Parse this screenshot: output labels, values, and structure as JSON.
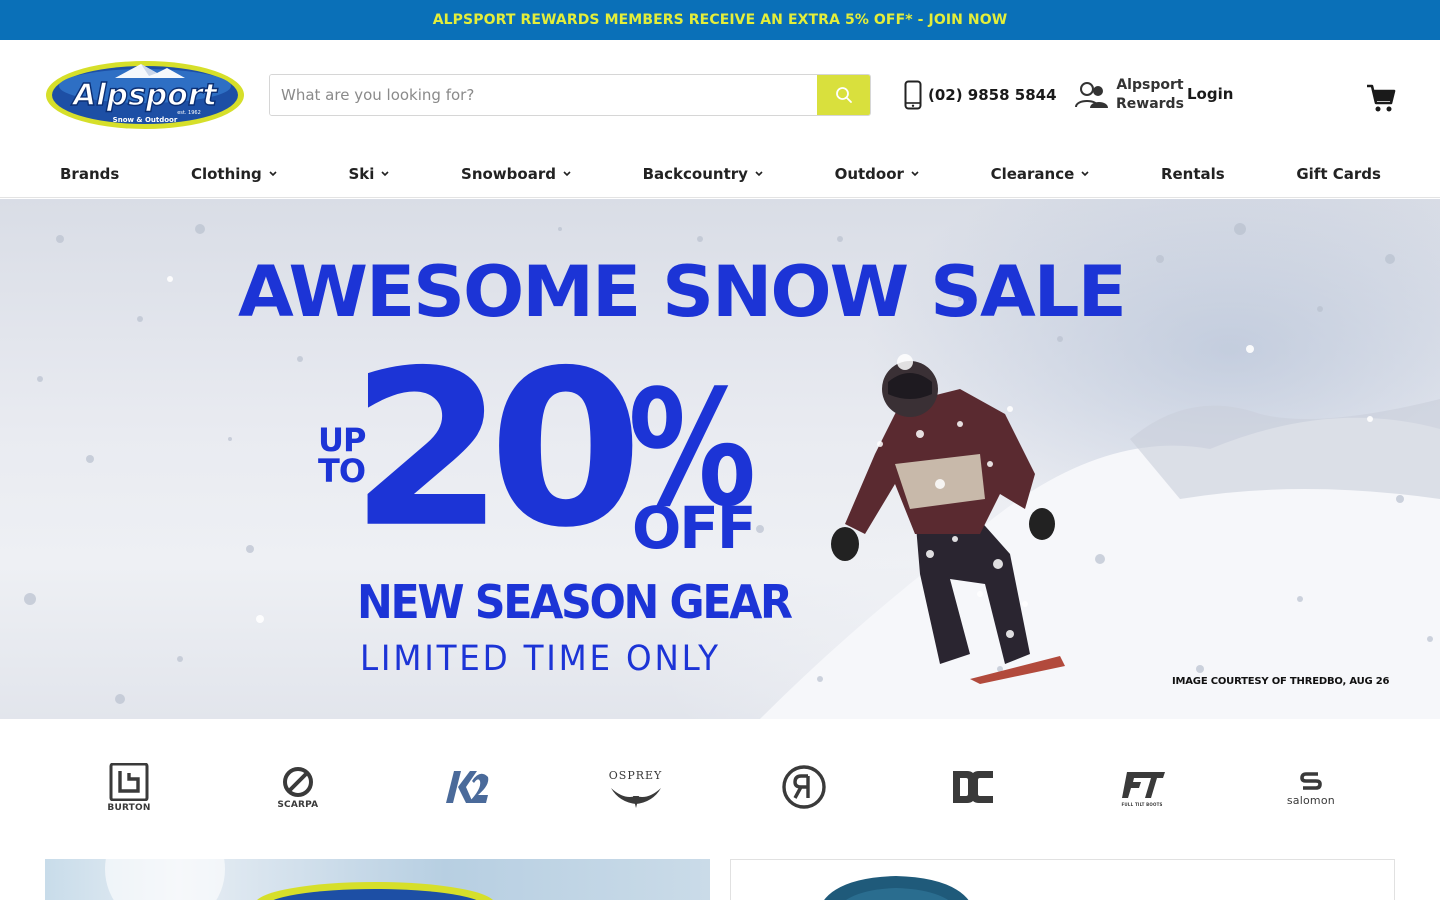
{
  "announcement": {
    "text": "ALPSPORT REWARDS MEMBERS RECEIVE AN EXTRA 5% OFF* - JOIN NOW",
    "text_color": "#e4ee3a",
    "background": "#0a70b8"
  },
  "header": {
    "logo": {
      "name": "Alpsport",
      "est": "est. 1962",
      "tagline": "Snow & Outdoor"
    },
    "search": {
      "placeholder": "What are you looking for?",
      "button_color": "#d9e03d"
    },
    "phone": "(02) 9858 5844",
    "rewards": {
      "line1": "Alpsport",
      "line2": "Rewards"
    },
    "login": "Login"
  },
  "nav": {
    "items": [
      {
        "label": "Brands",
        "dropdown": false
      },
      {
        "label": "Clothing",
        "dropdown": true
      },
      {
        "label": "Ski",
        "dropdown": true
      },
      {
        "label": "Snowboard",
        "dropdown": true
      },
      {
        "label": "Backcountry",
        "dropdown": true
      },
      {
        "label": "Outdoor",
        "dropdown": true
      },
      {
        "label": "Clearance",
        "dropdown": true
      },
      {
        "label": "Rentals",
        "dropdown": false
      },
      {
        "label": "Gift Cards",
        "dropdown": false
      }
    ]
  },
  "hero": {
    "title": "AWESOME SNOW SALE",
    "up_to_line1": "UP",
    "up_to_line2": "TO",
    "discount": "20",
    "percent": "%",
    "off": "OFF",
    "subtitle": "NEW SEASON GEAR",
    "limited": "LIMITED TIME ONLY",
    "credit": "IMAGE COURTESY OF THREDBO, AUG 26",
    "accent_color": "#1c34d6"
  },
  "brands": [
    {
      "name": "burton-logo",
      "label": "BURTON"
    },
    {
      "name": "scarpa-logo",
      "label": "SCARPA"
    },
    {
      "name": "k2-logo",
      "label": ""
    },
    {
      "name": "osprey-logo",
      "label": "OSPREY"
    },
    {
      "name": "rojo-logo",
      "label": ""
    },
    {
      "name": "dc-logo",
      "label": ""
    },
    {
      "name": "full-tilt-logo",
      "label": "FULL TILT BOOTS"
    },
    {
      "name": "salomon-logo",
      "label": "salomon"
    }
  ]
}
